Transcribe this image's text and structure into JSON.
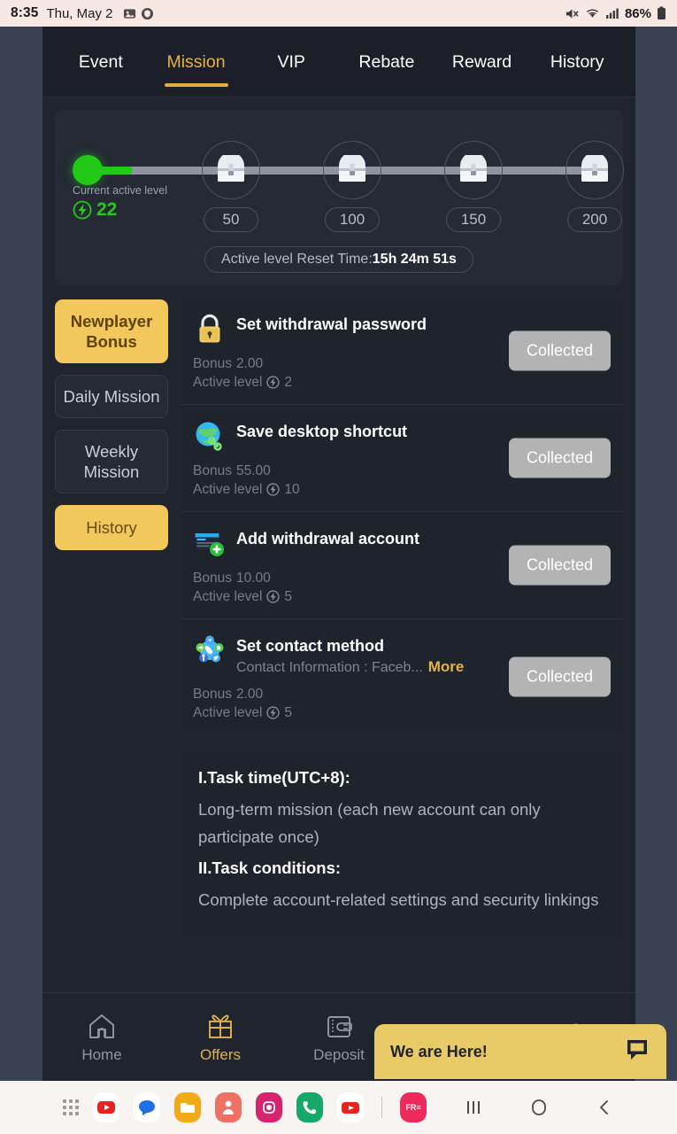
{
  "statusbar": {
    "time": "8:35",
    "date": "Thu, May 2",
    "battery": "86%",
    "icons": [
      "image-icon",
      "shield-icon",
      "mute-icon",
      "wifi-icon",
      "signal-icon",
      "battery-icon"
    ]
  },
  "tabs": [
    {
      "label": "Event",
      "active": false
    },
    {
      "label": "Mission",
      "active": true
    },
    {
      "label": "VIP",
      "active": false
    },
    {
      "label": "Rebate",
      "active": false
    },
    {
      "label": "Reward",
      "active": false
    },
    {
      "label": "History",
      "active": false
    }
  ],
  "progress": {
    "current_label": "Current active level",
    "current_value": "22",
    "milestones": [
      "50",
      "100",
      "150",
      "200"
    ],
    "reset_prefix": "Active level Reset Time:",
    "reset_time": "15h 24m 51s",
    "fill_color": "#22c917"
  },
  "sidebar": {
    "items": [
      {
        "label": "Newplayer Bonus",
        "state": "selected"
      },
      {
        "label": "Daily Mission",
        "state": "normal"
      },
      {
        "label": "Weekly Mission",
        "state": "normal"
      },
      {
        "label": "History",
        "state": "highlight"
      }
    ]
  },
  "missions": [
    {
      "icon": "lock-icon",
      "title": "Set withdrawal password",
      "subtitle": "",
      "more": "",
      "bonus_label": "Bonus",
      "bonus_value": "2.00",
      "level_label": "Active level",
      "level_value": "2",
      "button": "Collected"
    },
    {
      "icon": "globe-link-icon",
      "title": "Save desktop shortcut",
      "subtitle": "",
      "more": "",
      "bonus_label": "Bonus",
      "bonus_value": "55.00",
      "level_label": "Active level",
      "level_value": "10",
      "button": "Collected"
    },
    {
      "icon": "card-add-icon",
      "title": "Add withdrawal account",
      "subtitle": "",
      "more": "",
      "bonus_label": "Bonus",
      "bonus_value": "10.00",
      "level_label": "Active level",
      "level_value": "5",
      "button": "Collected"
    },
    {
      "icon": "contact-social-icon",
      "title": "Set contact method",
      "subtitle": "Contact Information : Faceb...",
      "more": "More",
      "bonus_label": "Bonus",
      "bonus_value": "2.00",
      "level_label": "Active level",
      "level_value": "5",
      "button": "Collected"
    }
  ],
  "description": {
    "heading1": "I.Task time(UTC+8):",
    "para1": "Long-term mission (each new account can only participate once)",
    "heading2": "II.Task conditions:",
    "para2": "Complete account-related settings and security linkings"
  },
  "bottomnav": {
    "items": [
      {
        "label": "Home",
        "icon": "home-icon",
        "active": false
      },
      {
        "label": "Offers",
        "icon": "gift-icon",
        "active": true
      },
      {
        "label": "Deposit",
        "icon": "wallet-icon",
        "active": false
      },
      {
        "label": "",
        "icon": "share-icon",
        "active": false
      },
      {
        "label": "",
        "icon": "profile-icon",
        "active": false
      }
    ]
  },
  "chat_widget": {
    "text": "We are Here!",
    "icon": "chat-bubble-icon",
    "color": "#e8cb66"
  },
  "dock": {
    "apps": [
      "apps-grid-icon",
      "youtube-music-icon",
      "messages-icon",
      "files-icon",
      "contacts-icon",
      "instagram-icon",
      "phone-icon",
      "youtube-icon",
      "free-icon"
    ],
    "nav": [
      "recents-button",
      "home-button",
      "back-button"
    ]
  }
}
